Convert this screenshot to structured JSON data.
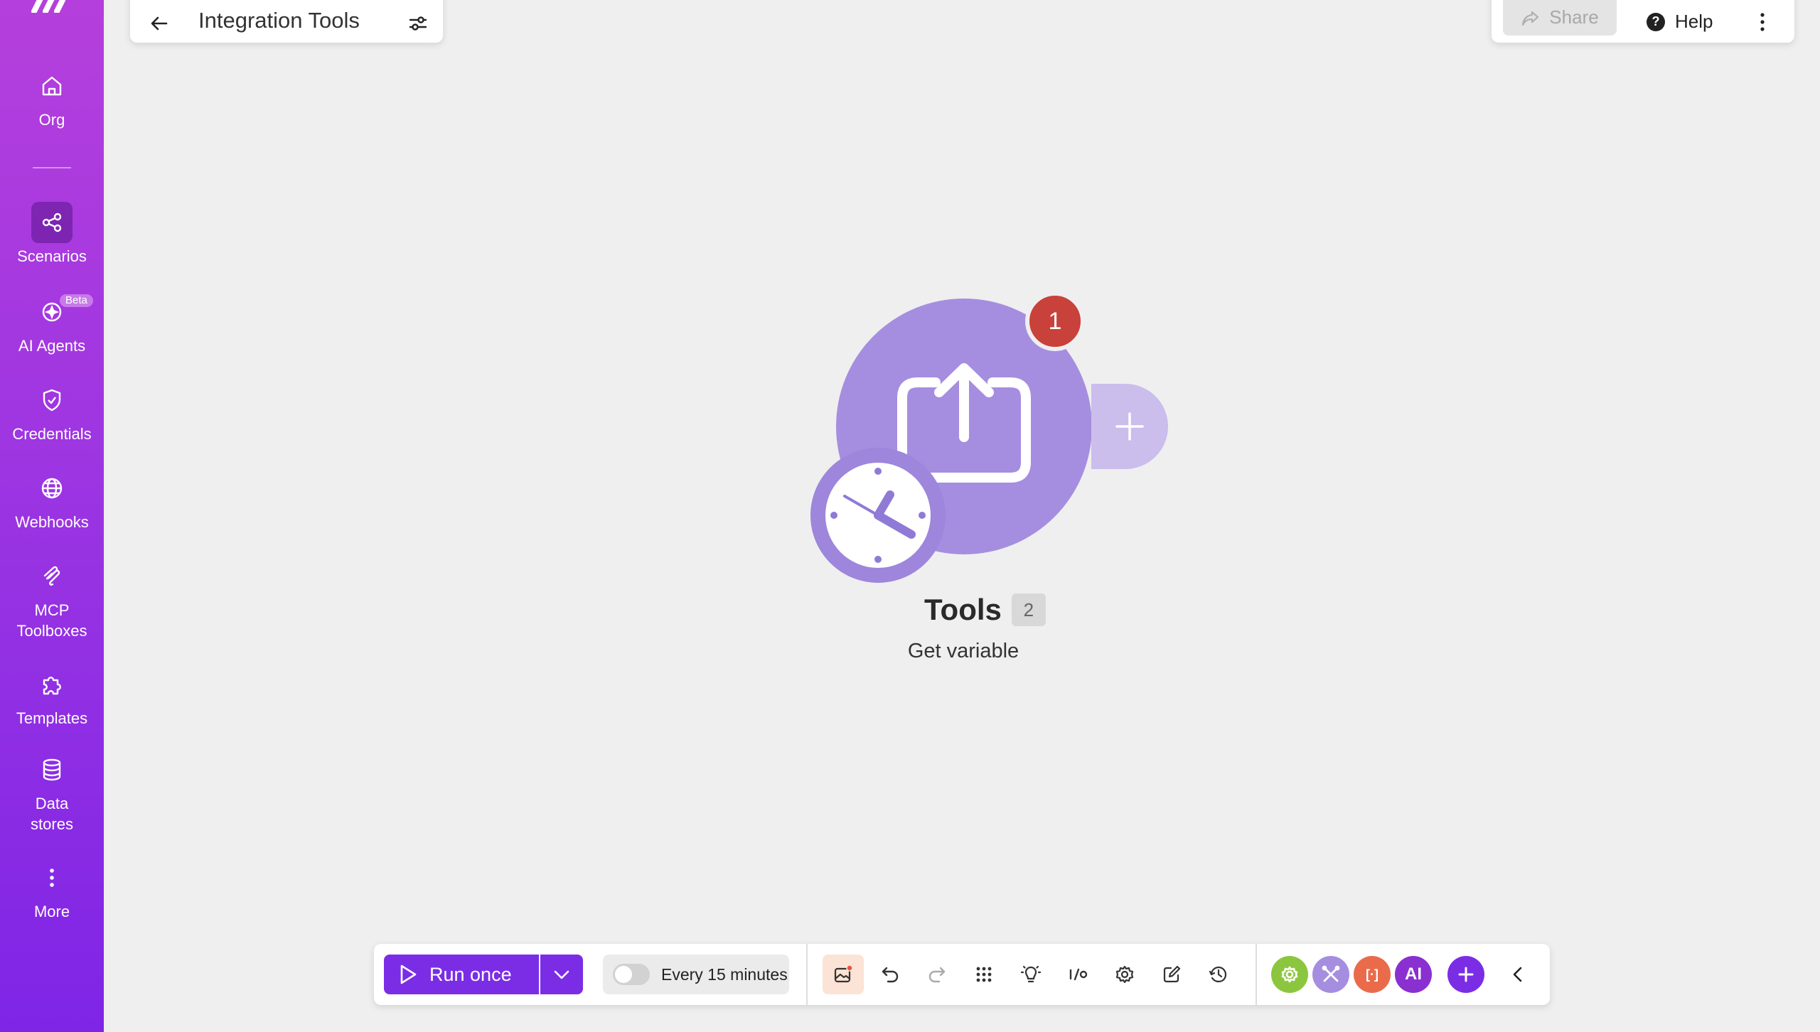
{
  "sidebar": {
    "items": [
      {
        "label": "Org",
        "icon": "home-icon"
      },
      {
        "label": "Scenarios",
        "icon": "share-nodes-icon"
      },
      {
        "label": "AI Agents",
        "icon": "sparkle-icon",
        "badge": "Beta"
      },
      {
        "label": "Credentials",
        "icon": "shield-check-icon"
      },
      {
        "label": "Webhooks",
        "icon": "globe-icon"
      },
      {
        "label": "MCP\nToolboxes",
        "icon": "mcp-icon"
      },
      {
        "label": "Templates",
        "icon": "puzzle-icon"
      },
      {
        "label": "Data\nstores",
        "icon": "database-icon"
      },
      {
        "label": "More",
        "icon": "vertical-dots-icon"
      }
    ],
    "colors": {
      "top": "#b53fdc",
      "bottom": "#7f25e6"
    }
  },
  "header": {
    "title": "Integration Tools"
  },
  "top_right": {
    "share_label": "Share",
    "help_label": "Help"
  },
  "module": {
    "name": "Tools",
    "count": "2",
    "subtitle": "Get variable",
    "error_badge": "1",
    "color": "#a58ee0"
  },
  "toolbar": {
    "run_label": "Run once",
    "schedule_label": "Every 15 minutes",
    "apps": [
      {
        "icon": "gear-icon",
        "color": "#8cc63f"
      },
      {
        "icon": "tools-icon",
        "color": "#a58ee0"
      },
      {
        "text": "[·]",
        "color": "#ea6b4a"
      },
      {
        "text": "AI",
        "color": "#8a2fd0"
      }
    ],
    "accent": "#7b2de6"
  }
}
